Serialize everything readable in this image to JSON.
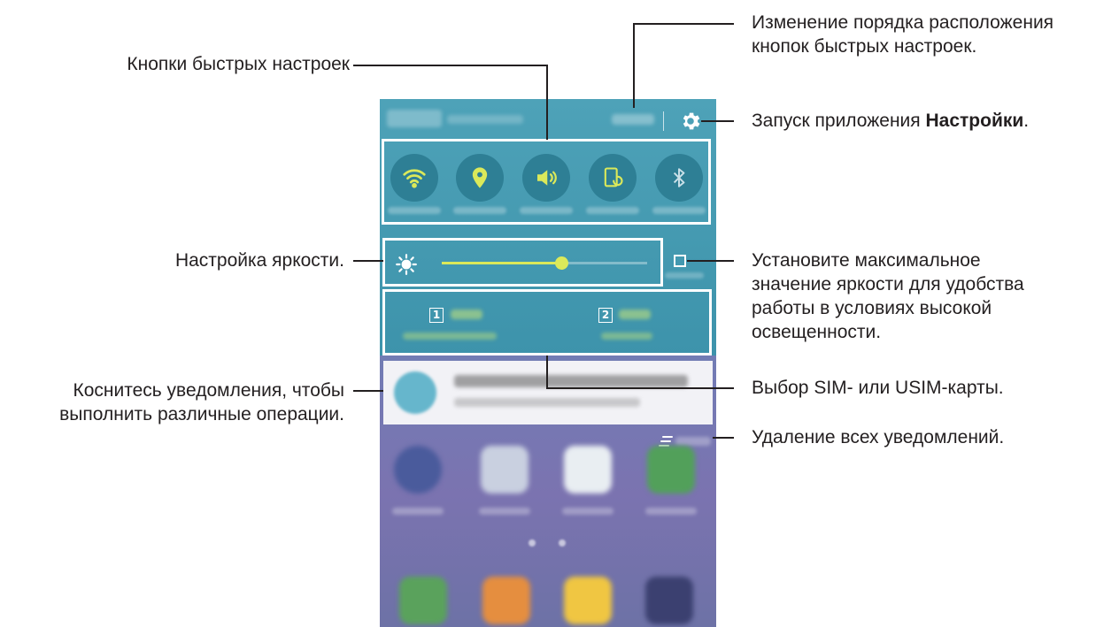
{
  "callouts": {
    "quick_buttons": "Кнопки быстрых настроек",
    "reorder_line1": "Изменение порядка расположения",
    "reorder_line2": "кнопок быстрых настроек.",
    "settings_prefix": "Запуск приложения ",
    "settings_bold": "Настройки",
    "settings_suffix": ".",
    "brightness": "Настройка яркости.",
    "outdoor_line1": "Установите максимальное",
    "outdoor_line2": "значение яркости для удобства",
    "outdoor_line3": "работы в условиях высокой",
    "outdoor_line4": "освещенности.",
    "notif_line1": "Коснитесь уведомления, чтобы",
    "notif_line2": "выполнить различные операции.",
    "sim": "Выбор SIM- или USIM-карты.",
    "clear": "Удаление всех уведомлений."
  },
  "phone": {
    "sim1_number": "1",
    "sim2_number": "2",
    "brightness_level": 0.58,
    "colors": {
      "panel": "#4ea2b8",
      "qs_button": "#2e7f95",
      "accent": "#dbe95a",
      "frame": "#ffffff"
    },
    "quick_settings_icons": [
      "wifi-icon",
      "location-icon",
      "sound-icon",
      "screen-rotation-icon",
      "bluetooth-icon"
    ],
    "home_apps_icons": [
      "internet-icon",
      "camera-icon",
      "play-store-icon",
      "google-folder-icon"
    ],
    "dock_icons": [
      "phone-icon",
      "contacts-icon",
      "messages-icon",
      "apps-icon"
    ]
  }
}
